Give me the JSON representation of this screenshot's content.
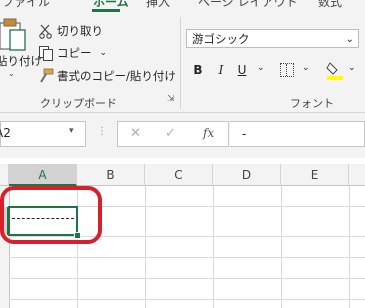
{
  "ribbon_tabs": [
    "ファイル",
    "ホーム",
    "挿入",
    "ページ レイアウト",
    "数式"
  ],
  "ribbon_tabs_active": "ホーム",
  "clipboard": {
    "paste_label": "貼り付け",
    "cut_label": "切り取り",
    "copy_label": "コピー",
    "format_painter_label": "書式のコピー/貼り付け",
    "group_label": "クリップボード"
  },
  "font": {
    "font_name": "游ゴシック",
    "bold_label": "B",
    "italic_label": "I",
    "underline_label": "U",
    "group_label": "フォント"
  },
  "formula_bar": {
    "name_box": "A2",
    "fx_label": "fx",
    "formula_value": "-"
  },
  "columns": [
    "A",
    "B",
    "C",
    "D",
    "E"
  ],
  "selected_cell": "A2",
  "colors": {
    "accent": "#217346",
    "annotation": "#d91f2a"
  }
}
